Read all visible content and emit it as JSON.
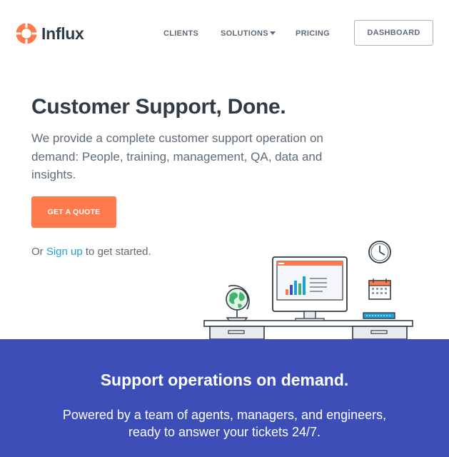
{
  "header": {
    "logo_text": "Influx",
    "nav": [
      {
        "label": "CLIENTS"
      },
      {
        "label": "SOLUTIONS"
      },
      {
        "label": "PRICING"
      }
    ],
    "dashboard_label": "DASHBOARD"
  },
  "hero": {
    "title": "Customer Support, Done.",
    "subtitle": "We provide a complete customer support operation on demand: People, training, management, QA, data and insights.",
    "cta_label": "GET A QUOTE",
    "signup_prefix": "Or ",
    "signup_link": "Sign up",
    "signup_suffix": " to get started."
  },
  "band": {
    "title": "Support operations on demand.",
    "text_line1": "Powered by a team of agents, managers, and engineers,",
    "text_line2": "ready to answer your tickets 24/7."
  },
  "colors": {
    "accent_orange": "#ff7a4d",
    "link_blue": "#1ea2d9",
    "band_blue": "#3d4eb8",
    "text_dark": "#2f3b45"
  },
  "icons": {
    "logo": "lifebuoy-icon",
    "solutions_dropdown": "caret-down-icon"
  }
}
